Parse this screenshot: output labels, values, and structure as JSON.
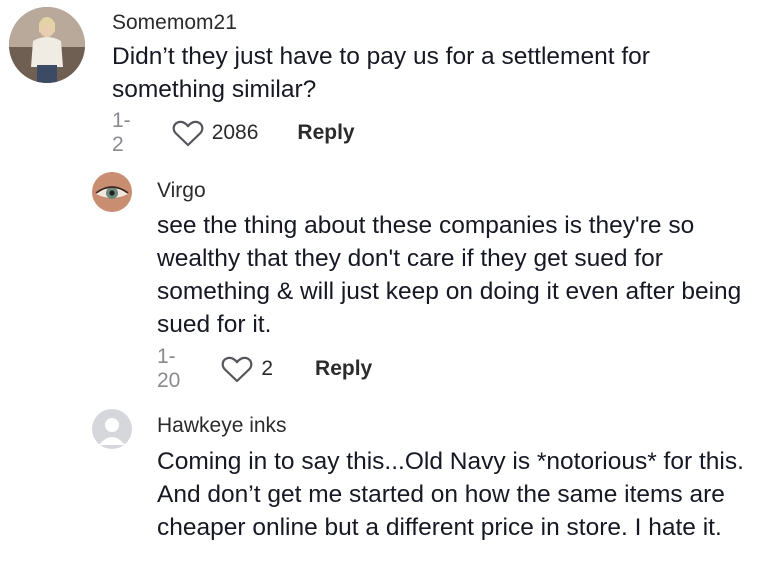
{
  "comments": [
    {
      "username": "Somemom21",
      "text": "Didn’t they just have to pay us for a settlement for something similar?",
      "date": "1-2",
      "likes": "2086",
      "reply_label": "Reply"
    },
    {
      "username": "Virgo",
      "text": "see the thing about these companies is they're so wealthy that they don't care if they get sued for something & will just keep on doing it even after being sued for it.",
      "date": "1-20",
      "likes": "2",
      "reply_label": "Reply"
    },
    {
      "username": "Hawkeye inks",
      "text": "Coming in to say this...Old Navy is *notorious* for this. And don’t get me started on how the same items are cheaper online but a different price in store. I hate it."
    }
  ]
}
